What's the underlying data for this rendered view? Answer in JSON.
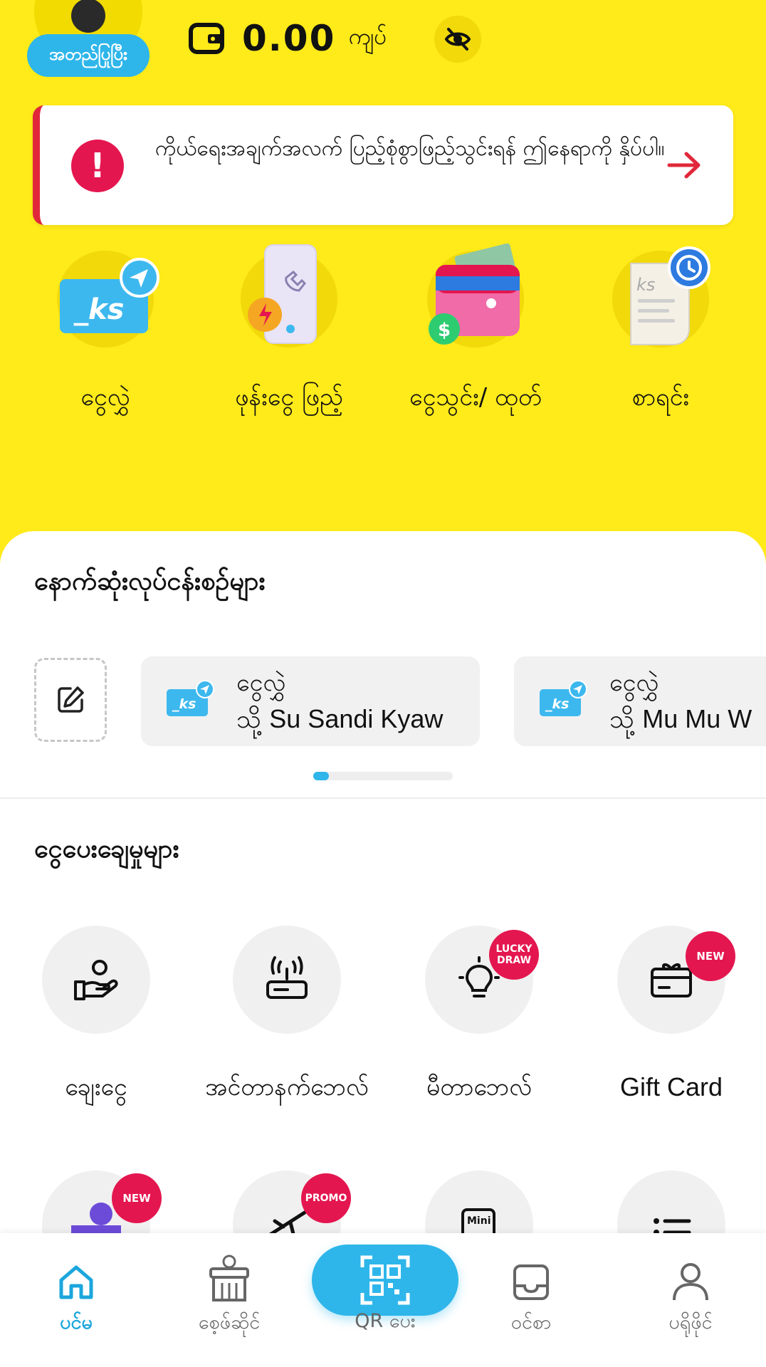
{
  "header": {
    "verified_label": "အတည်ပြုပြီး",
    "balance": "0.00",
    "currency": "ကျပ်"
  },
  "alert": {
    "icon_text": "!",
    "message": "ကိုယ်ရေးအချက်အလက် ပြည့်စုံစွာဖြည့်သွင်းရန် ဤနေရာကို နှိပ်ပါ။"
  },
  "quick_actions": [
    {
      "label": "ငွေလွှဲ",
      "icon": "transfer-icon"
    },
    {
      "label": "ဖုန်းငွေ ဖြည့်",
      "icon": "topup-icon"
    },
    {
      "label": "ငွေသွင်း/ ထုတ်",
      "icon": "cash-in-out-icon"
    },
    {
      "label": "စာရင်း",
      "icon": "history-icon"
    }
  ],
  "recent": {
    "title": "နောက်ဆုံးလုပ်ငန်းစဉ်များ",
    "items": [
      {
        "type": "ငွေလွှဲ",
        "to_prefix": "သို့",
        "name": "Su Sandi Kyaw"
      },
      {
        "type": "ငွေလွှဲ",
        "to_prefix": "သို့",
        "name": "Mu Mu W"
      }
    ],
    "pager_position": 0.1
  },
  "payments": {
    "title": "ငွေပေးချေမှုများ",
    "items": [
      {
        "label": "ချေးငွေ",
        "icon": "loan-icon"
      },
      {
        "label": "အင်တာနက်ဘေလ်",
        "icon": "router-icon"
      },
      {
        "label": "မီတာဘေလ်",
        "icon": "bulb-icon",
        "tag": "LUCKY DRAW"
      },
      {
        "label": "Gift Card",
        "icon": "gift-card-icon",
        "tag": "NEW"
      }
    ],
    "partial_tags": [
      "NEW",
      "PROMO"
    ],
    "partial_icons": [
      "shop-icon",
      "plane-icon",
      "mini-app-icon",
      "list-icon"
    ]
  },
  "nav": {
    "home": "ပင်မ",
    "shop": "စေ့ဖ်ဆိုင်",
    "qr": "QR ပေး",
    "inbox": "ဝင်စာ",
    "profile": "ပရိုဖိုင်"
  },
  "colors": {
    "brand_yellow": "#FFEA1A",
    "accent_blue": "#2EB6EA",
    "alert_red": "#E4164F"
  }
}
